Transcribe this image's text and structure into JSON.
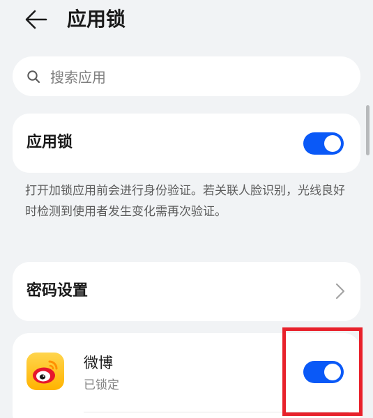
{
  "header": {
    "title": "应用锁",
    "back_icon": "arrow-left-icon"
  },
  "search": {
    "placeholder": "搜索应用",
    "icon": "search-icon"
  },
  "app_lock": {
    "label": "应用锁",
    "enabled": true,
    "description": "打开加锁应用前会进行身份验证。若关联人脸识别，光线良好时检测到使用者发生变化需再次验证。"
  },
  "password_settings": {
    "label": "密码设置",
    "icon": "chevron-right-icon"
  },
  "apps": [
    {
      "name": "微博",
      "status": "已锁定",
      "locked": true,
      "icon": "weibo-app-icon"
    }
  ],
  "colors": {
    "accent": "#0a59f7",
    "background": "#f1f3f5",
    "highlight": "#e8212b"
  }
}
